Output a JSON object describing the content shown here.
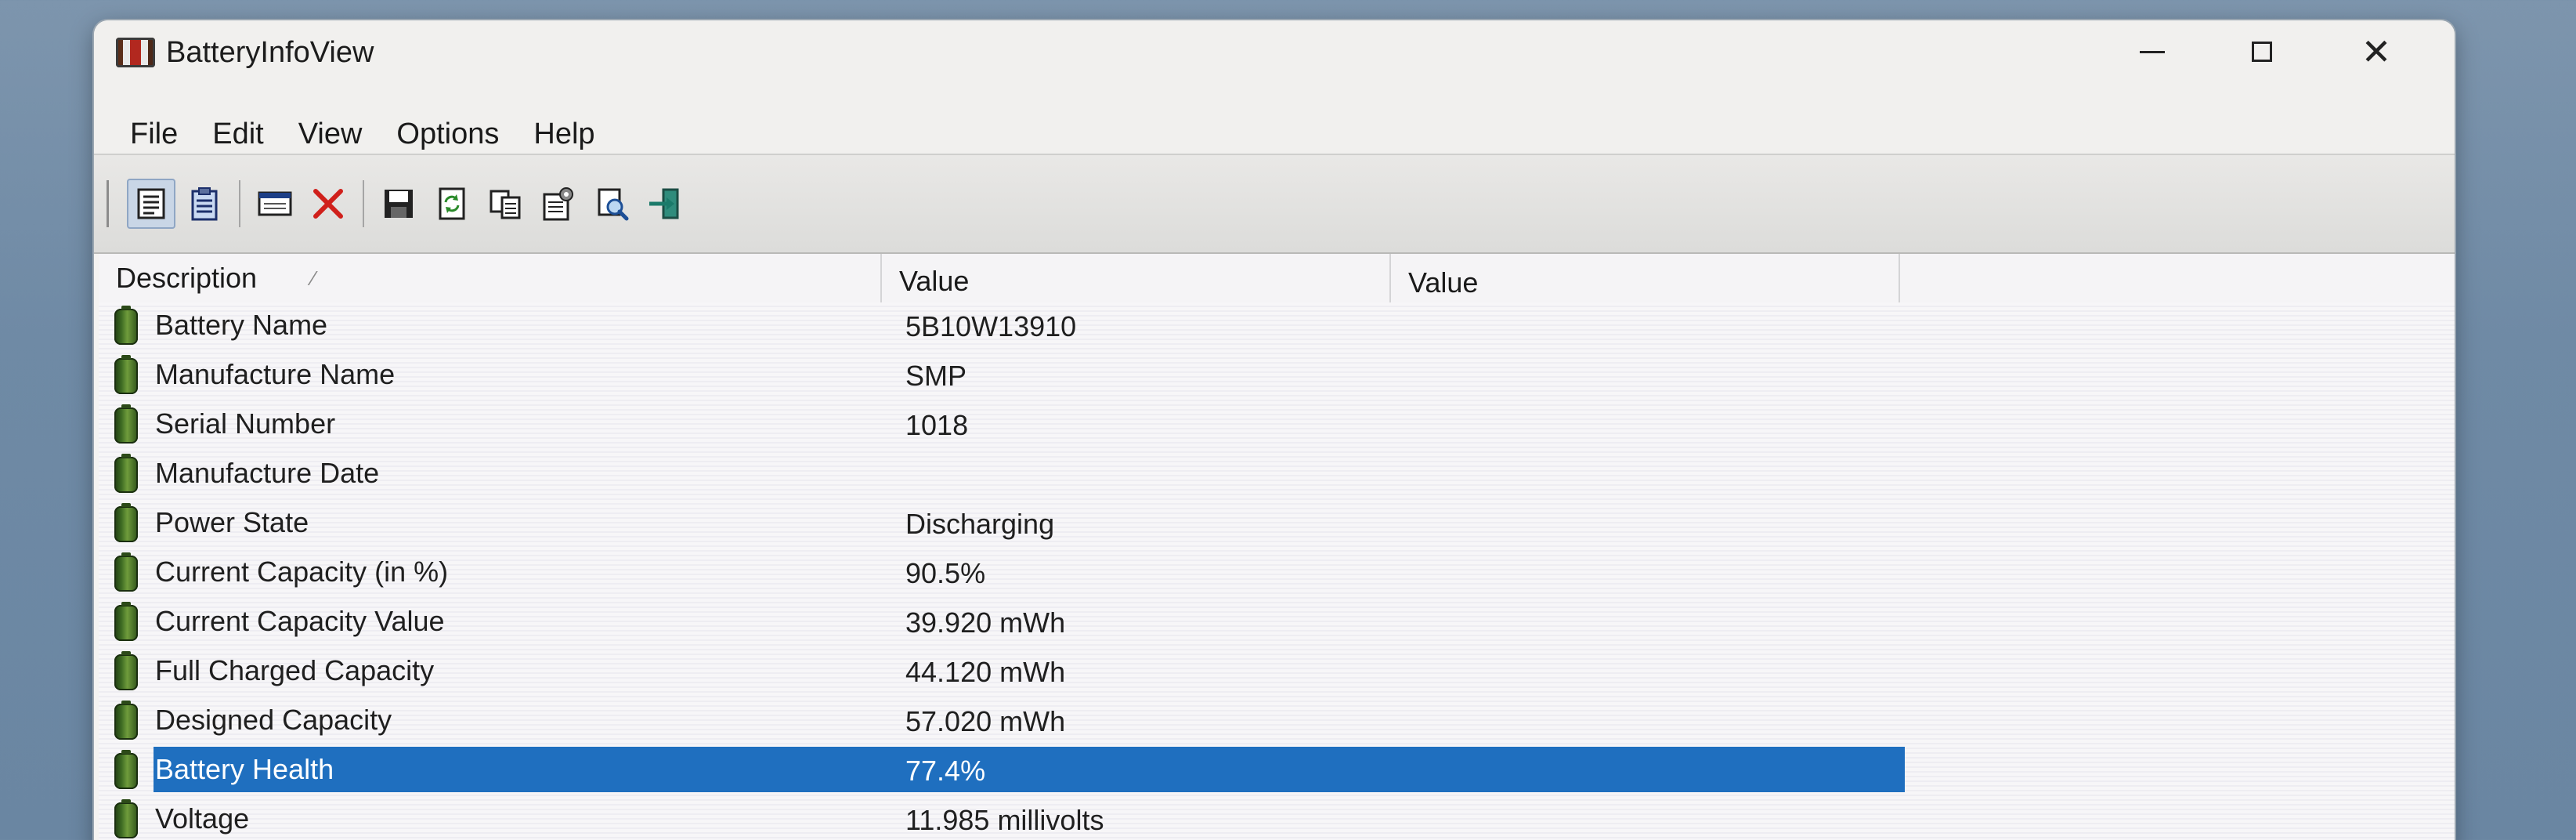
{
  "window": {
    "title": "BatteryInfoView"
  },
  "menu": {
    "items": [
      "File",
      "Edit",
      "View",
      "Options",
      "Help"
    ]
  },
  "toolbar": {
    "buttons": [
      "properties-icon",
      "clipboard-report-icon",
      "window-icon",
      "delete-icon",
      "save-icon",
      "refresh-icon",
      "copy-icon",
      "options-icon",
      "find-icon",
      "exit-icon"
    ]
  },
  "columns": [
    "Description",
    "Value",
    "Value"
  ],
  "rows": [
    {
      "description": "Battery Name",
      "value": "5B10W13910"
    },
    {
      "description": "Manufacture Name",
      "value": "SMP"
    },
    {
      "description": "Serial Number",
      "value": " 1018"
    },
    {
      "description": "Manufacture Date",
      "value": ""
    },
    {
      "description": "Power State",
      "value": "Discharging"
    },
    {
      "description": "Current Capacity (in %)",
      "value": "90.5%"
    },
    {
      "description": "Current Capacity Value",
      "value": "39.920 mWh"
    },
    {
      "description": "Full Charged Capacity",
      "value": "44.120 mWh"
    },
    {
      "description": "Designed Capacity",
      "value": "57.020 mWh"
    },
    {
      "description": "Battery Health",
      "value": "77.4%",
      "selected": true
    },
    {
      "description": "Voltage",
      "value": "11.985 millivolts"
    }
  ],
  "colors": {
    "selection": "#1f6fbf",
    "window_bg": "#f4f3f1",
    "desktop": "#6f8aa5"
  }
}
